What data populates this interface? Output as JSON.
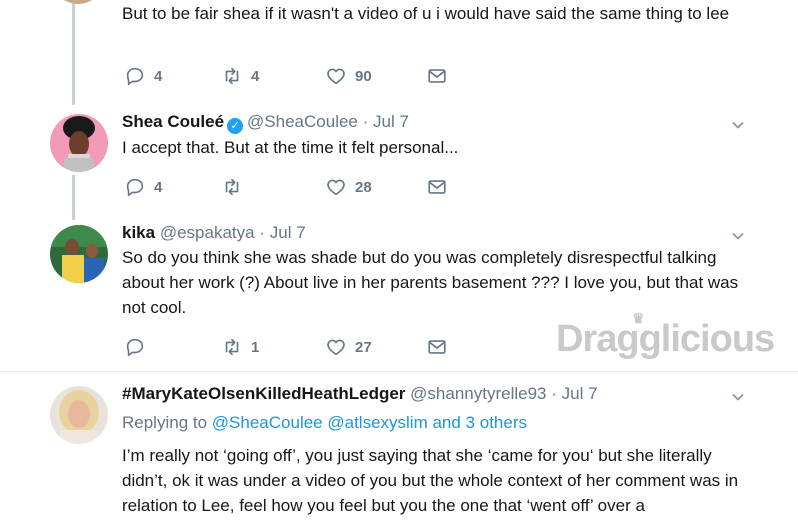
{
  "tweet0": {
    "text": "But to be fair shea if it wasn't a video of u i would have said the same thing to lee",
    "replies": "4",
    "retweets": "4",
    "likes": "90"
  },
  "tweet1": {
    "name": "Shea Couleé",
    "handle": "@SheaCoulee",
    "dot": "·",
    "date": "Jul 7",
    "text": "I accept that. But at the time it felt personal...",
    "replies": "4",
    "retweets": "",
    "likes": "28"
  },
  "tweet2": {
    "name": "kika",
    "handle": "@espakatya",
    "dot": "·",
    "date": "Jul 7",
    "text": "So do you think she was shade but do you was completely disrespectful talking about her work (?) About live in her parents basement ??? I love you, but that was not cool.",
    "replies": "",
    "retweets": "1",
    "likes": "27"
  },
  "tweet3": {
    "name": "#MaryKateOlsenKilledHeathLedger",
    "handle": "@shannytyrelle93",
    "dot": "·",
    "date": "Jul 7",
    "replying_prefix": "Replying to",
    "replying_users": "@SheaCoulee @atlsexyslim",
    "replying_suffix": "and 3 others",
    "text": "I’m really not ‘going off’, you just saying that she ‘came for you‘ but she literally didn’t, ok it was under a video of you but the whole context of her comment was in relation to Lee, feel how you feel but you the one that ‘went off’ over a"
  },
  "watermark": {
    "text_a": "Drag",
    "text_b": "licious",
    "glyph": "g"
  },
  "icons": {
    "reply": "reply-icon",
    "retweet": "retweet-icon",
    "like": "heart-icon",
    "dm": "envelope-icon",
    "more": "chevron-down-icon",
    "verified": "verified-badge-icon"
  },
  "colors": {
    "link": "#1b95e0",
    "verified": "#1da1f2",
    "muted": "#657786",
    "thread_line": "#c4cfd6"
  }
}
